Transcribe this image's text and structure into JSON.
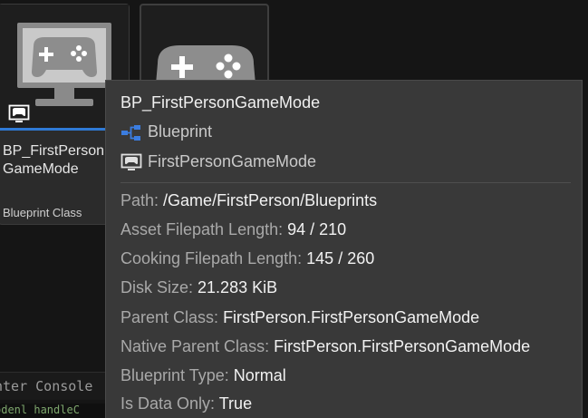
{
  "asset_tile_1": {
    "name": "BP_FirstPersonGameMode",
    "name_display": "BP_FirstPerson GameMode",
    "class": "Blueprint Class",
    "icon": "gamepad-monitor-icon",
    "badge_icon": "gamemode-badge-icon"
  },
  "asset_tile_2": {
    "icon": "gamepad-icon"
  },
  "console": {
    "header_text": "nter Console",
    "log_text": "odenl handleC"
  },
  "tooltip": {
    "title": "BP_FirstPersonGameMode",
    "type_label": "Blueprint",
    "type_icon": "blueprint-icon",
    "parent_label": "FirstPersonGameMode",
    "parent_icon": "gamemode-badge-icon",
    "properties": [
      {
        "key": "Path:",
        "value": "/Game/FirstPerson/Blueprints"
      },
      {
        "key": "Asset Filepath Length:",
        "value": "94 / 210"
      },
      {
        "key": "Cooking Filepath Length:",
        "value": "145 / 260"
      },
      {
        "key": "Disk Size:",
        "value": "21.283 KiB"
      },
      {
        "key": "Parent Class:",
        "value": "FirstPerson.FirstPersonGameMode"
      },
      {
        "key": "Native Parent Class:",
        "value": "FirstPerson.FirstPersonGameMode"
      },
      {
        "key": "Blueprint Type:",
        "value": "Normal"
      },
      {
        "key": "Is Data Only:",
        "value": "True"
      }
    ]
  },
  "colors": {
    "selection_accent": "#2f7ad6",
    "blueprint_icon": "#3b7de0",
    "tooltip_bg": "#393939"
  }
}
